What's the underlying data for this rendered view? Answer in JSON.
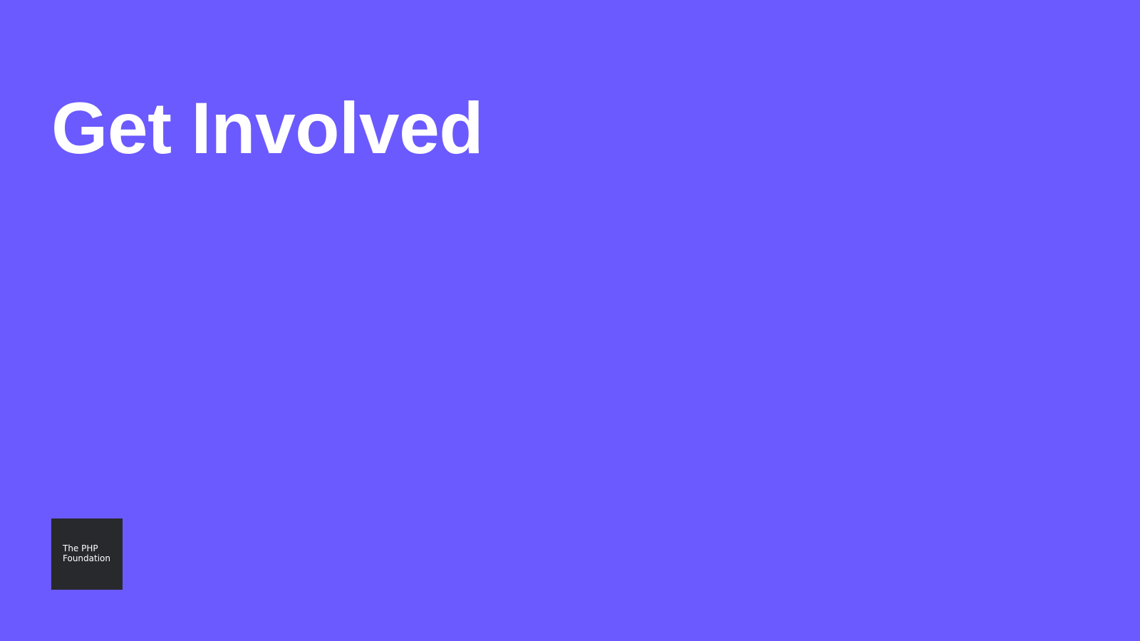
{
  "slide": {
    "title": "Get Involved",
    "background_color": "#6b5aff",
    "logo": {
      "text_line1": "The PHP",
      "text_line2": "Foundation"
    }
  }
}
